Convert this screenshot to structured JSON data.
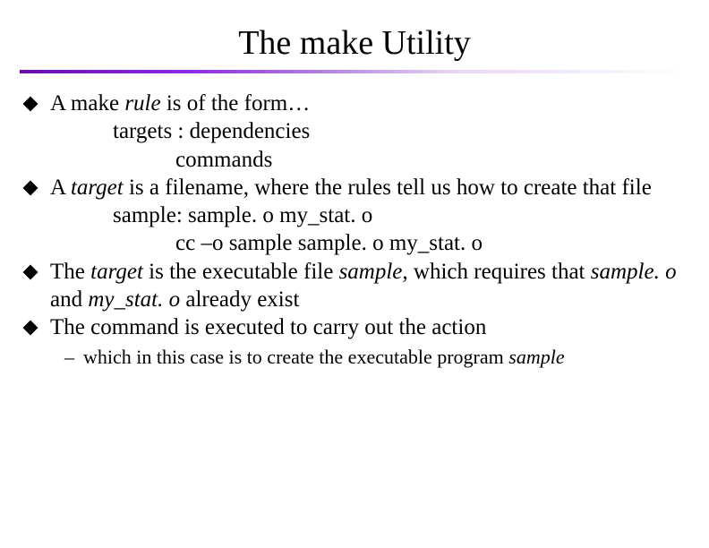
{
  "title": "The make Utility",
  "b1": {
    "pre": "A make ",
    "it": "rule",
    "post": " is of the form…"
  },
  "b1_line2": "targets : dependencies",
  "b1_line3": "commands",
  "b2": {
    "pre": "A ",
    "it": "target",
    "post": " is a filename, where the rules tell us how to create that file"
  },
  "b2_line2": "sample:  sample. o  my_stat. o",
  "b2_line3": "cc –o sample sample. o my_stat. o",
  "b3": {
    "p1": "The ",
    "i1": "target",
    "p2": " is the executable file ",
    "i2": "sample",
    "p3": ", which requires that ",
    "i3": "sample. o",
    "p4": " and ",
    "i4": "my_stat. o",
    "p5": " already exist"
  },
  "b4": "The command is executed to carry out the action",
  "sub": {
    "dash": "–",
    "p1": "which in this case is to create the executable program ",
    "i1": "sample"
  }
}
